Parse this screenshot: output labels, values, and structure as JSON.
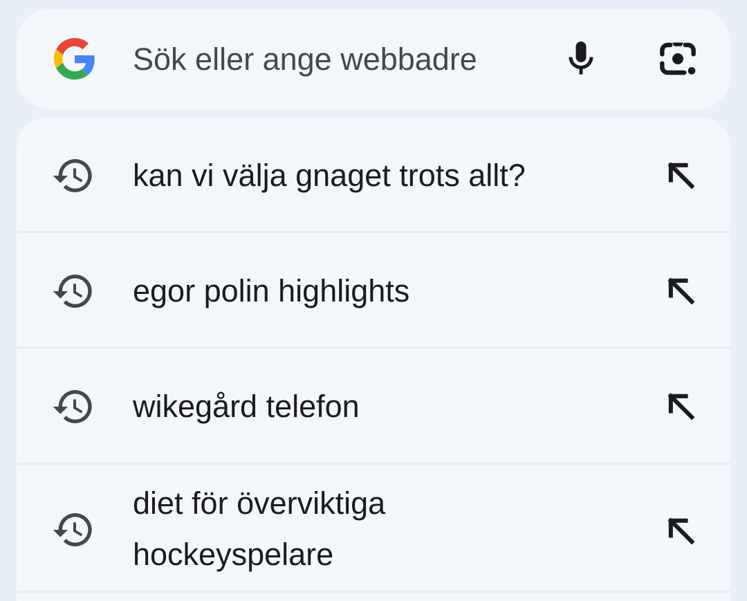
{
  "search": {
    "placeholder": "Sök eller ange webbadre",
    "logo_icon": "google-g-icon",
    "mic_icon": "mic-icon",
    "lens_icon": "google-lens-icon"
  },
  "suggestions": [
    {
      "text": "kan vi välja gnaget trots allt?",
      "icon": "history-icon",
      "action_icon": "arrow-up-left-icon"
    },
    {
      "text": "egor polin highlights",
      "icon": "history-icon",
      "action_icon": "arrow-up-left-icon"
    },
    {
      "text": "wikegård telefon",
      "icon": "history-icon",
      "action_icon": "arrow-up-left-icon"
    },
    {
      "text": "diet för överviktiga hockeyspelare",
      "icon": "history-icon",
      "action_icon": "arrow-up-left-icon"
    }
  ],
  "colors": {
    "background": "#e8eff8",
    "surface": "#f3f7fc",
    "text": "#1b1b1f",
    "google_blue": "#4285F4",
    "google_red": "#EA4335",
    "google_yellow": "#FBBC05",
    "google_green": "#34A853"
  }
}
